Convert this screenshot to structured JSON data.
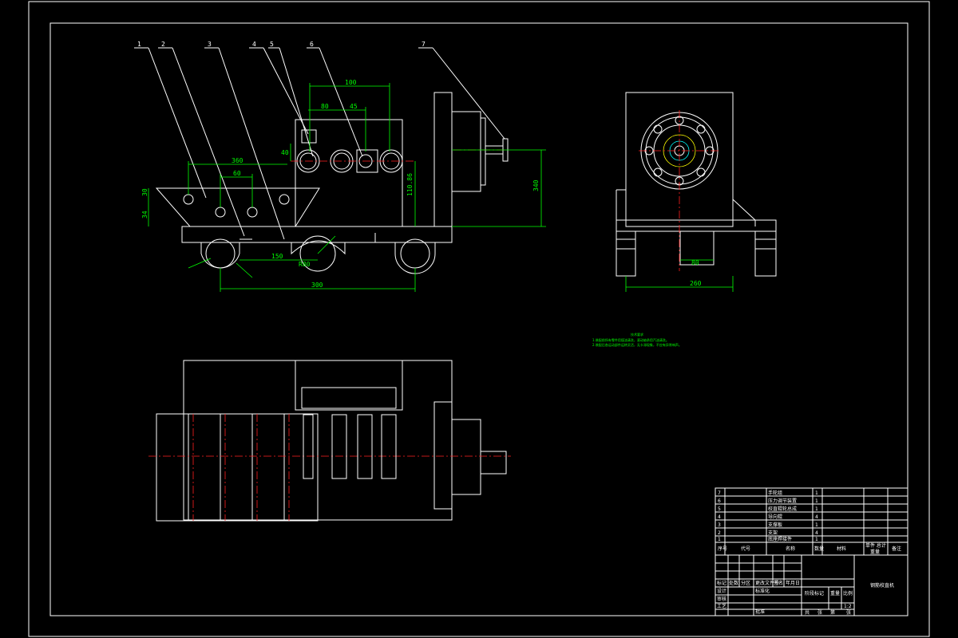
{
  "dimensions": {
    "main": [
      "100",
      "80",
      "45",
      "40",
      "360",
      "60",
      "110.86",
      "340",
      "150",
      "R80",
      "30",
      "34",
      "300"
    ],
    "side": [
      "80",
      "260"
    ]
  },
  "balloons": [
    "1",
    "2",
    "3",
    "4",
    "5",
    "6",
    "7"
  ],
  "technical_notes": {
    "title": "技术要求",
    "line1": "1.装配前所有零件用煤油清洗，滚动轴承用汽油清洗。",
    "line2": "2.装配后各运动部件运转灵活，无卡滞现象，不应有异常响声。"
  },
  "parts_list": {
    "rows": [
      {
        "no": "7",
        "name": "手轮组",
        "qty": "1"
      },
      {
        "no": "6",
        "name": "压力调节装置",
        "qty": "1"
      },
      {
        "no": "5",
        "name": "校直辊轮总成",
        "qty": "1"
      },
      {
        "no": "4",
        "name": "导向辊",
        "qty": "4"
      },
      {
        "no": "3",
        "name": "支撑板",
        "qty": "1"
      },
      {
        "no": "2",
        "name": "支架",
        "qty": "4"
      },
      {
        "no": "1",
        "name": "底座焊接件",
        "qty": "1"
      }
    ],
    "header": {
      "no": "序号",
      "code": "代号",
      "name": "名称",
      "qty": "数量",
      "material": "材料",
      "unit_total": "单件 总计",
      "weight": "重量",
      "remark": "备注"
    }
  },
  "title_block": {
    "drawing_name": "钢筋校直机",
    "labels": [
      "标记",
      "处数",
      "分区",
      "更改文件号",
      "签名",
      "年月日",
      "设计",
      "标准化",
      "审核",
      "工艺",
      "批准",
      "阶段标记",
      "重量",
      "比例",
      "共",
      "张",
      "第",
      "张"
    ],
    "scale": "1:2"
  }
}
